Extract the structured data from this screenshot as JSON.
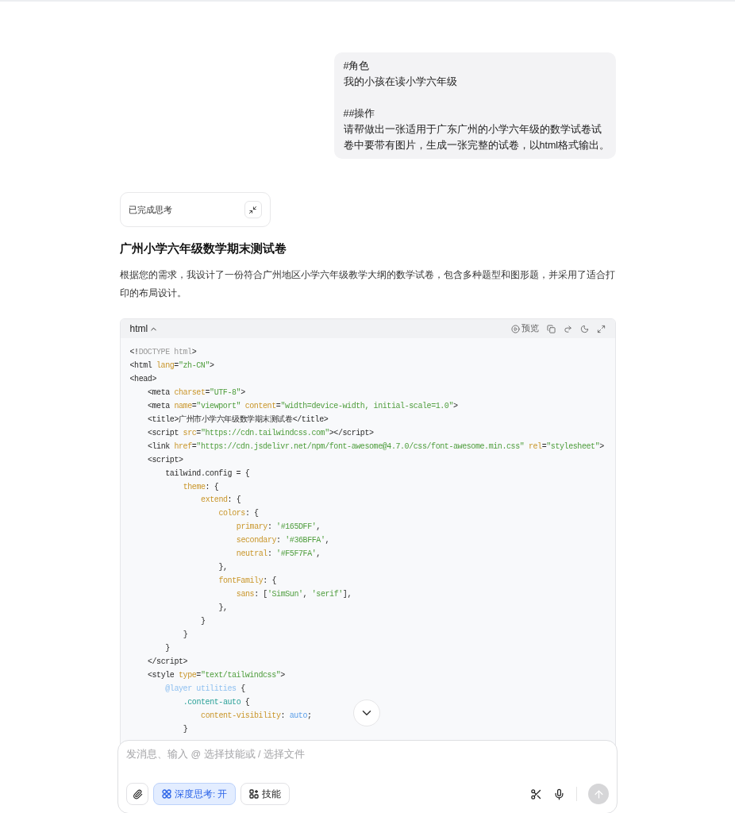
{
  "user_message": {
    "paragraphs": [
      [
        "#角色",
        "我的小孩在读小学六年级"
      ],
      [
        "##操作",
        "请帮做出一张适用于广东广州的小学六年级的数学试卷试卷中要带有图片，生成一张完整的试卷，以html格式输出。"
      ]
    ]
  },
  "thinking": {
    "label": "已完成思考"
  },
  "answer": {
    "title": "广州小学六年级数学期末测试卷",
    "intro": "根据您的需求，我设计了一份符合广州地区小学六年级教学大纲的数学试卷，包含多种题型和图形题，并采用了适合打印的布局设计。"
  },
  "code_block": {
    "language": "html",
    "preview_label": "预览",
    "lines": [
      {
        "tokens": [
          {
            "kind": "plain",
            "text": "<!"
          },
          {
            "kind": "comment",
            "text": "DOCTYPE html"
          },
          {
            "kind": "plain",
            "text": ">"
          }
        ]
      },
      {
        "tokens": [
          {
            "kind": "plain",
            "text": "<html "
          },
          {
            "kind": "attr",
            "text": "lang"
          },
          {
            "kind": "plain",
            "text": "="
          },
          {
            "kind": "str",
            "text": "\"zh-CN\""
          },
          {
            "kind": "plain",
            "text": ">"
          }
        ]
      },
      {
        "tokens": [
          {
            "kind": "plain",
            "text": "<head>"
          }
        ],
        "children": [
          {
            "tokens": [
              {
                "kind": "plain",
                "text": "<meta "
              },
              {
                "kind": "attr",
                "text": "charset"
              },
              {
                "kind": "plain",
                "text": "="
              },
              {
                "kind": "str",
                "text": "\"UTF-8\""
              },
              {
                "kind": "plain",
                "text": ">"
              }
            ]
          },
          {
            "tokens": [
              {
                "kind": "plain",
                "text": "<meta "
              },
              {
                "kind": "attr",
                "text": "name"
              },
              {
                "kind": "plain",
                "text": "="
              },
              {
                "kind": "str",
                "text": "\"viewport\""
              },
              {
                "kind": "attr",
                "text": " content"
              },
              {
                "kind": "plain",
                "text": "="
              },
              {
                "kind": "str",
                "text": "\"width=device-width, initial-scale=1.0\""
              },
              {
                "kind": "plain",
                "text": ">"
              }
            ]
          },
          {
            "tokens": [
              {
                "kind": "plain",
                "text": "<title>广州市小学六年级数学期末测试卷</title>"
              }
            ]
          },
          {
            "tokens": [
              {
                "kind": "plain",
                "text": "<script "
              },
              {
                "kind": "attr",
                "text": "src"
              },
              {
                "kind": "plain",
                "text": "="
              },
              {
                "kind": "str",
                "text": "\"https://cdn.tailwindcss.com\""
              },
              {
                "kind": "plain",
                "text": "></script>"
              }
            ]
          },
          {
            "tokens": [
              {
                "kind": "plain",
                "text": "<link "
              },
              {
                "kind": "attr",
                "text": "href"
              },
              {
                "kind": "plain",
                "text": "="
              },
              {
                "kind": "str",
                "text": "\"https://cdn.jsdelivr.net/npm/font-awesome@4.7.0/css/font-awesome.min.css\""
              },
              {
                "kind": "attr",
                "text": " rel"
              },
              {
                "kind": "plain",
                "text": "="
              },
              {
                "kind": "str",
                "text": "\"stylesheet\""
              },
              {
                "kind": "plain",
                "text": ">"
              }
            ]
          },
          {
            "tokens": [
              {
                "kind": "plain",
                "text": "<script>"
              }
            ],
            "children": [
              {
                "tokens": [
                  {
                    "kind": "plain",
                    "text": "tailwind.config = {"
                  }
                ],
                "children": [
                  {
                    "tokens": [
                      {
                        "kind": "attr",
                        "text": "theme"
                      },
                      {
                        "kind": "plain",
                        "text": ": {"
                      }
                    ],
                    "children": [
                      {
                        "tokens": [
                          {
                            "kind": "attr",
                            "text": "extend"
                          },
                          {
                            "kind": "plain",
                            "text": ": {"
                          }
                        ],
                        "children": [
                          {
                            "tokens": [
                              {
                                "kind": "attr",
                                "text": "colors"
                              },
                              {
                                "kind": "plain",
                                "text": ": {"
                              }
                            ],
                            "children": [
                              {
                                "tokens": [
                                  {
                                    "kind": "attr",
                                    "text": "primary"
                                  },
                                  {
                                    "kind": "plain",
                                    "text": ": "
                                  },
                                  {
                                    "kind": "str",
                                    "text": "'#165DFF'"
                                  },
                                  {
                                    "kind": "plain",
                                    "text": ","
                                  }
                                ]
                              },
                              {
                                "tokens": [
                                  {
                                    "kind": "attr",
                                    "text": "secondary"
                                  },
                                  {
                                    "kind": "plain",
                                    "text": ": "
                                  },
                                  {
                                    "kind": "str",
                                    "text": "'#36BFFA'"
                                  },
                                  {
                                    "kind": "plain",
                                    "text": ","
                                  }
                                ]
                              },
                              {
                                "tokens": [
                                  {
                                    "kind": "attr",
                                    "text": "neutral"
                                  },
                                  {
                                    "kind": "plain",
                                    "text": ": "
                                  },
                                  {
                                    "kind": "str",
                                    "text": "'#F5F7FA'"
                                  },
                                  {
                                    "kind": "plain",
                                    "text": ","
                                  }
                                ]
                              }
                            ]
                          },
                          {
                            "tokens": [
                              {
                                "kind": "plain",
                                "text": "},"
                              }
                            ]
                          },
                          {
                            "tokens": [
                              {
                                "kind": "attr",
                                "text": "fontFamily"
                              },
                              {
                                "kind": "plain",
                                "text": ": {"
                              }
                            ],
                            "children": [
                              {
                                "tokens": [
                                  {
                                    "kind": "attr",
                                    "text": "sans"
                                  },
                                  {
                                    "kind": "plain",
                                    "text": ": ["
                                  },
                                  {
                                    "kind": "str",
                                    "text": "'SimSun'"
                                  },
                                  {
                                    "kind": "plain",
                                    "text": ", "
                                  },
                                  {
                                    "kind": "str",
                                    "text": "'serif'"
                                  },
                                  {
                                    "kind": "plain",
                                    "text": "],"
                                  }
                                ]
                              }
                            ]
                          },
                          {
                            "tokens": [
                              {
                                "kind": "plain",
                                "text": "},"
                              }
                            ]
                          }
                        ]
                      },
                      {
                        "tokens": [
                          {
                            "kind": "plain",
                            "text": "}"
                          }
                        ]
                      }
                    ]
                  },
                  {
                    "tokens": [
                      {
                        "kind": "plain",
                        "text": "}"
                      }
                    ]
                  }
                ]
              },
              {
                "tokens": [
                  {
                    "kind": "plain",
                    "text": "}"
                  }
                ]
              }
            ]
          },
          {
            "tokens": [
              {
                "kind": "plain",
                "text": "</script>"
              }
            ]
          },
          {
            "tokens": [
              {
                "kind": "plain",
                "text": "<style "
              },
              {
                "kind": "attr",
                "text": "type"
              },
              {
                "kind": "plain",
                "text": "="
              },
              {
                "kind": "str",
                "text": "\"text/tailwindcss\""
              },
              {
                "kind": "plain",
                "text": ">"
              }
            ],
            "children": [
              {
                "tokens": [
                  {
                    "kind": "at",
                    "text": "@layer utilities"
                  },
                  {
                    "kind": "plain",
                    "text": " {"
                  }
                ],
                "children": [
                  {
                    "tokens": [
                      {
                        "kind": "selector",
                        "text": ".content-auto"
                      },
                      {
                        "kind": "plain",
                        "text": " {"
                      }
                    ],
                    "children": [
                      {
                        "tokens": [
                          {
                            "kind": "attr",
                            "text": "content-visibility"
                          },
                          {
                            "kind": "plain",
                            "text": ": "
                          },
                          {
                            "kind": "value",
                            "text": "auto"
                          },
                          {
                            "kind": "plain",
                            "text": ";"
                          }
                        ]
                      }
                    ]
                  },
                  {
                    "tokens": [
                      {
                        "kind": "plain",
                        "text": "}"
                      }
                    ]
                  }
                ]
              }
            ]
          }
        ]
      }
    ]
  },
  "composer": {
    "placeholder": "发消息、输入 @ 选择技能或 / 选择文件",
    "deep_thinking": {
      "label": "深度思考: 开",
      "selected": true
    },
    "skills": {
      "label": "技能"
    }
  }
}
